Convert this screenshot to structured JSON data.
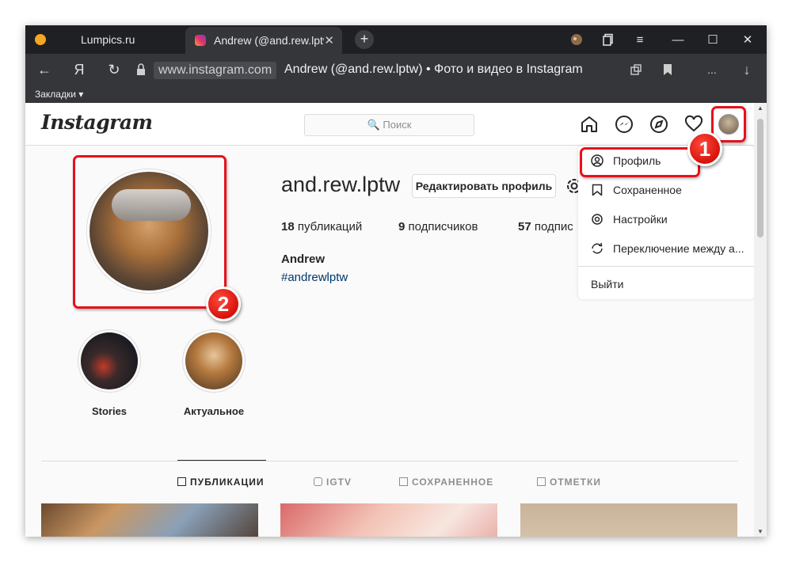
{
  "browser": {
    "tabs": [
      {
        "label": "Lumpics.ru"
      },
      {
        "label": "Andrew (@and.rew.lptw",
        "close": "✕"
      }
    ],
    "new_tab": "+",
    "window_controls": {
      "menu": "≡",
      "minimize": "—",
      "maximize": "☐",
      "close": "✕"
    },
    "nav": {
      "back": "←",
      "yandex": "Я",
      "reload": "↻"
    },
    "url_domain": "www.instagram.com",
    "url_title": "Andrew (@and.rew.lptw) • Фото и видео в Instagram",
    "addr_right": {
      "more": "...",
      "download": "↓"
    },
    "bookmarks_label": "Закладки ▾"
  },
  "instagram": {
    "logo": "Instagram",
    "search_placeholder": "🔍 Поиск",
    "profile": {
      "username": "and.rew.lptw",
      "edit_button": "Редактировать профиль",
      "stats": [
        {
          "count": "18",
          "label": " публикаций"
        },
        {
          "count": "9",
          "label": " подписчиков"
        },
        {
          "count": "57",
          "label": " подпис"
        }
      ],
      "full_name": "Andrew",
      "hashtag": "#andrewlptw"
    },
    "highlights": [
      {
        "label": "Stories"
      },
      {
        "label": "Актуальное"
      }
    ],
    "post_tabs": [
      {
        "label": "ПУБЛИКАЦИИ",
        "active": true
      },
      {
        "label": "IGTV",
        "active": false
      },
      {
        "label": "СОХРАНЕННОЕ",
        "active": false
      },
      {
        "label": "ОТМЕТКИ",
        "active": false
      }
    ],
    "dropdown": {
      "items": [
        {
          "label": "Профиль",
          "icon": "profile-icon"
        },
        {
          "label": "Сохраненное",
          "icon": "bookmark-icon"
        },
        {
          "label": "Настройки",
          "icon": "settings-icon"
        },
        {
          "label": "Переключение между а...",
          "icon": "switch-icon"
        }
      ],
      "logout": "Выйти"
    }
  },
  "annotations": {
    "badge1": "1",
    "badge2": "2",
    "accent_color": "#e8101a"
  }
}
